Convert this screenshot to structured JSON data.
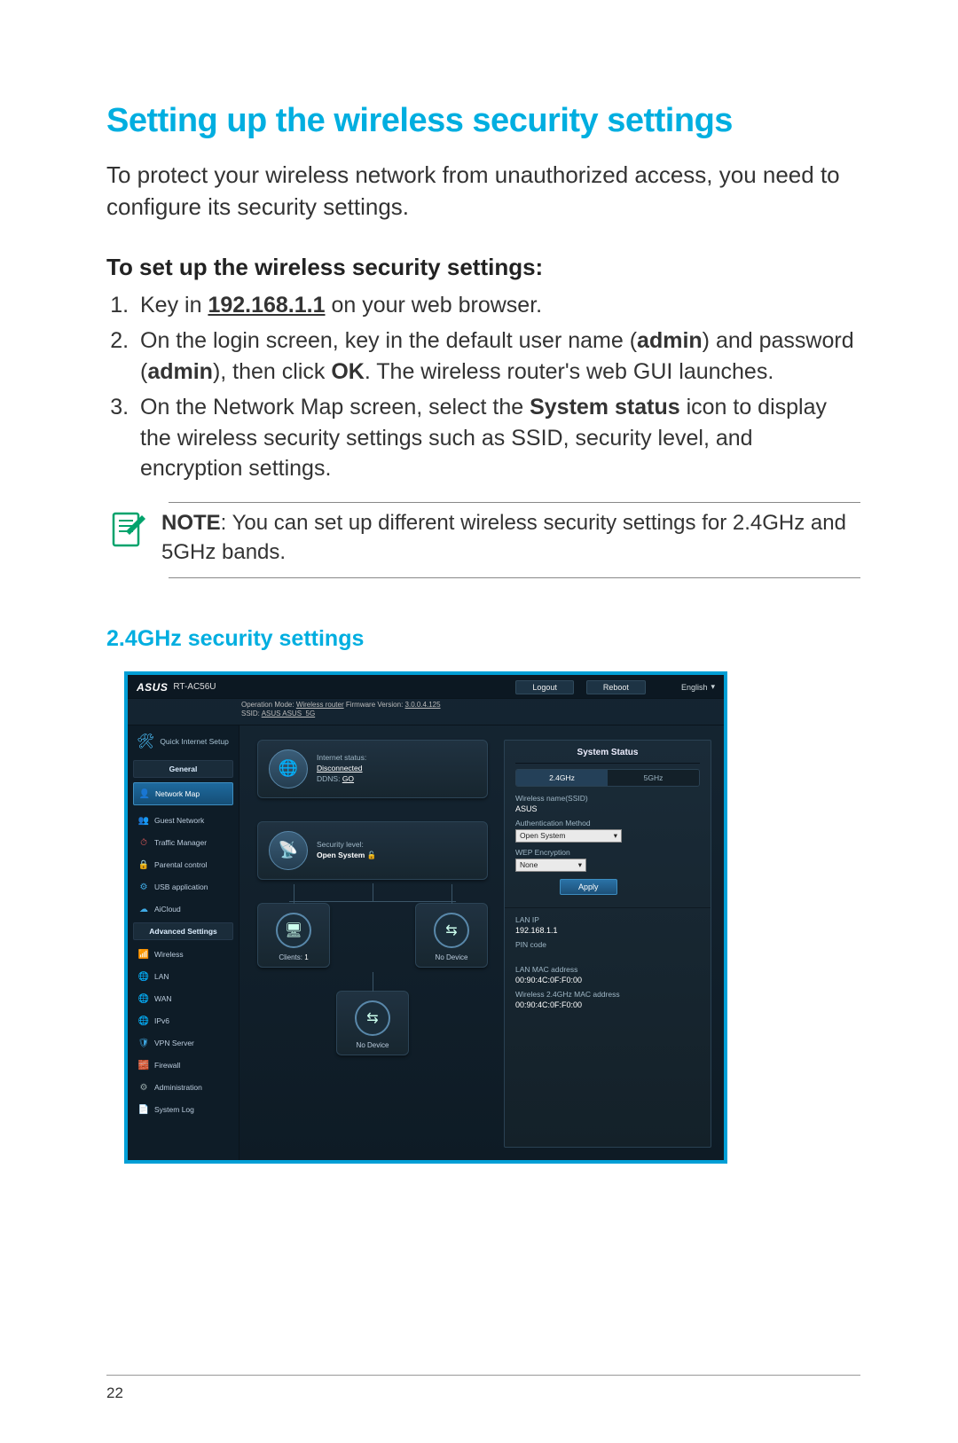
{
  "doc": {
    "title": "Setting up the wireless security settings",
    "intro": "To protect your wireless network from unauthorized access, you need to configure its security settings.",
    "sub_title": "To set up the wireless security settings:",
    "steps": {
      "s1_pre": "Key in ",
      "s1_ip": "192.168.1.1",
      "s1_post": " on your web browser.",
      "s2_pre": "On the login screen, key in the default user name (",
      "s2_admin": "admin",
      "s2_mid": ") and password (",
      "s2_ok_pre": "), then click ",
      "s2_ok": "OK",
      "s2_post": ". The wireless router's web GUI launches.",
      "s3_pre": "On the Network Map screen, select the ",
      "s3_bold": "System status",
      "s3_post": " icon  to display the wireless security settings such as SSID, security level, and encryption settings."
    },
    "note_label": "NOTE",
    "note_text": ":     You can set up different wireless security settings for 2.4GHz and 5GHz bands.",
    "band_title": "2.4GHz security settings",
    "page_number": "22"
  },
  "gui": {
    "brand": "ASUS",
    "model": "RT-AC56U",
    "btn_logout": "Logout",
    "btn_reboot": "Reboot",
    "lang": "English",
    "info_line1_pre": "Operation Mode: ",
    "info_line1_mode": "Wireless router",
    "info_line1_mid": "    Firmware Version: ",
    "info_line1_fw": "3.0.0.4.125",
    "info_line2_pre": "SSID: ",
    "info_line2_ssid": "ASUS  ASUS_5G",
    "sidebar": {
      "qis": "Quick Internet Setup",
      "header_general": "General",
      "items_general": [
        "Network Map",
        "Guest Network",
        "Traffic Manager",
        "Parental control",
        "USB application",
        "AiCloud"
      ],
      "header_adv": "Advanced Settings",
      "items_adv": [
        "Wireless",
        "LAN",
        "WAN",
        "IPv6",
        "VPN Server",
        "Firewall",
        "Administration",
        "System Log"
      ]
    },
    "cards": {
      "internet_label": "Internet status:",
      "internet_value": "Disconnected",
      "ddns_label": "DDNS: ",
      "ddns_value": "GO",
      "sec_label": "Security level:",
      "sec_value": "Open System",
      "clients_label": "Clients: ",
      "clients_value": "1",
      "no_device": "No Device"
    },
    "status": {
      "title": "System Status",
      "tab24": "2.4GHz",
      "tab5": "5GHz",
      "f_ssid": "Wireless name(SSID)",
      "v_ssid": "ASUS",
      "f_auth": "Authentication Method",
      "v_auth": "Open System",
      "f_wep": "WEP Encryption",
      "v_wep": "None",
      "apply": "Apply",
      "f_lanip": "LAN IP",
      "v_lanip": "192.168.1.1",
      "f_pin": "PIN code",
      "f_lanmac": "LAN MAC address",
      "v_lanmac": "00:90:4C:0F:F0:00",
      "f_wmac": "Wireless 2.4GHz MAC address",
      "v_wmac": "00:90:4C:0F:F0:00"
    }
  }
}
